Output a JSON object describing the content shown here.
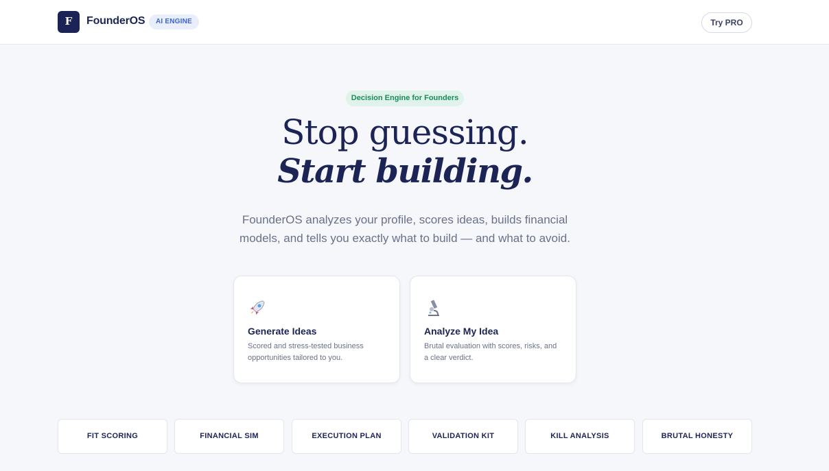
{
  "header": {
    "logo_letter": "F",
    "brand": "FounderOS",
    "badge": "AI ENGINE",
    "cta": "Try PRO"
  },
  "hero": {
    "pill": "Decision Engine for Founders",
    "title_line1": "Stop guessing.",
    "title_line2": "Start building.",
    "subtitle": "FounderOS analyzes your profile, scores ideas, builds financial models, and tells you exactly what to build — and what to avoid."
  },
  "cards": [
    {
      "icon": "rocket-icon",
      "title": "Generate Ideas",
      "desc": "Scored and stress-tested business opportunities tailored to you."
    },
    {
      "icon": "microscope-icon",
      "title": "Analyze My Idea",
      "desc": "Brutal evaluation with scores, risks, and a clear verdict."
    }
  ],
  "features": [
    "FIT SCORING",
    "FINANCIAL SIM",
    "EXECUTION PLAN",
    "VALIDATION KIT",
    "KILL ANALYSIS",
    "BRUTAL HONESTY"
  ],
  "colors": {
    "navy": "#1c2456",
    "accent_blue": "#3a63d6",
    "accent_green": "#1c8a5b",
    "background": "#f5f7fa"
  }
}
